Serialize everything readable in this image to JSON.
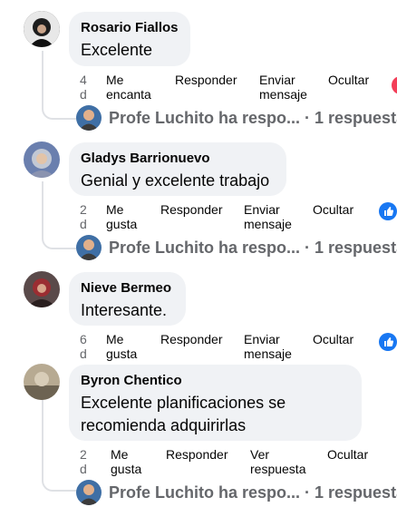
{
  "comments": [
    {
      "author": "Rosario Fiallos",
      "text": "Excelente",
      "time": [
        "4",
        "d"
      ],
      "reaction": [
        "Me",
        "encanta"
      ],
      "reply": "Responder",
      "message": [
        "Enviar",
        "mensaje"
      ],
      "hide": "Ocultar",
      "reply_summary": "Profe Luchito ha respo... · 1 respuesta"
    },
    {
      "author": "Gladys Barrionuevo",
      "text": "Genial y excelente trabajo",
      "time": [
        "2",
        "d"
      ],
      "reaction": [
        "Me",
        "gusta"
      ],
      "reply": "Responder",
      "message": [
        "Enviar",
        "mensaje"
      ],
      "hide": "Ocultar",
      "reply_summary": "Profe Luchito ha respo... · 1 respuesta"
    },
    {
      "author": "Nieve Bermeo",
      "text": "Interesante.",
      "time": [
        "6",
        "d"
      ],
      "reaction": [
        "Me",
        "gusta"
      ],
      "reply": "Responder",
      "message": [
        "Enviar",
        "mensaje"
      ],
      "hide": "Ocultar"
    },
    {
      "author": "Byron Chentico",
      "text_line1": "Excelente planificaciones se",
      "text_line2": "recomienda adquirirlas",
      "time": [
        "2",
        "d"
      ],
      "reaction": [
        "Me",
        "gusta"
      ],
      "reply": "Responder",
      "view_reply": [
        "Ver",
        "respuesta"
      ],
      "hide": "Ocultar",
      "reply_summary": "Profe Luchito ha respo... · 1 respuesta"
    }
  ],
  "colors": {
    "blue": "#0866ff",
    "red": "#e41e3f",
    "gray": "#65676b",
    "bubble": "#f0f2f5"
  },
  "icons": [
    "like-icon",
    "love-icon",
    "avatar"
  ]
}
